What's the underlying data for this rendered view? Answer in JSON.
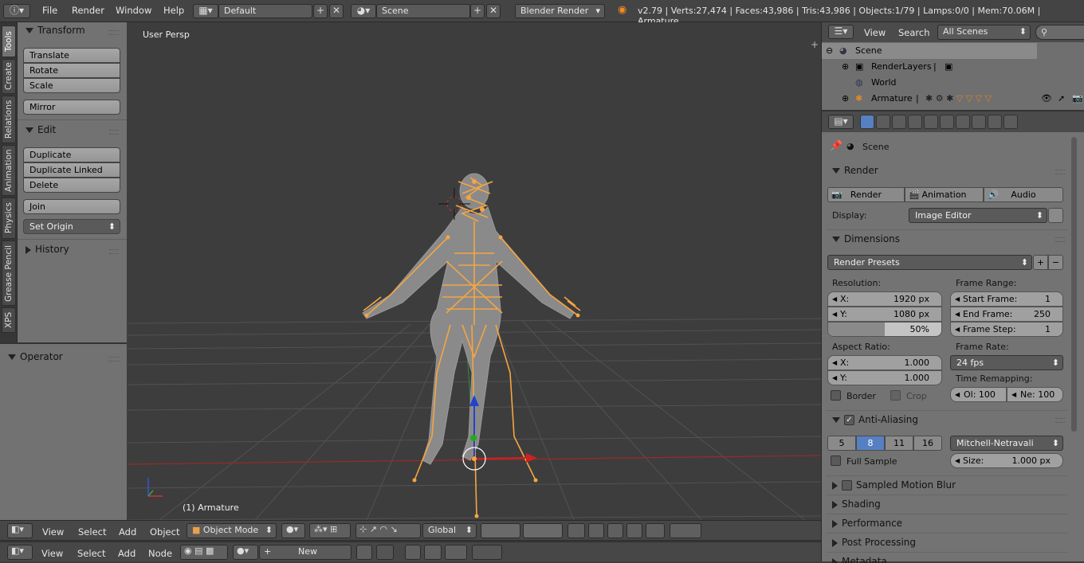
{
  "topbar": {
    "menus": [
      "File",
      "Render",
      "Window",
      "Help"
    ],
    "layout": "Default",
    "scene": "Scene",
    "engine": "Blender Render",
    "stats": "v2.79 | Verts:27,474 | Faces:43,986 | Tris:43,986 | Objects:1/79 | Lamps:0/0 | Mem:70.06M | Armature"
  },
  "tabs": [
    "Tools",
    "Create",
    "Relations",
    "Animation",
    "Physics",
    "Grease Pencil",
    "XPS"
  ],
  "toolshelf": {
    "transform": {
      "title": "Transform",
      "buttons": [
        "Translate",
        "Rotate",
        "Scale",
        "Mirror"
      ]
    },
    "edit": {
      "title": "Edit",
      "buttons": [
        "Duplicate",
        "Duplicate Linked",
        "Delete",
        "Join",
        "Set Origin"
      ]
    },
    "history": "History"
  },
  "operator": "Operator",
  "viewport": {
    "view_label": "User Persp",
    "object_label": "(1) Armature"
  },
  "view3d_header": {
    "menus": [
      "View",
      "Select",
      "Add",
      "Object"
    ],
    "mode": "Object Mode",
    "orientation": "Global"
  },
  "node_header": {
    "menus": [
      "View",
      "Select",
      "Add",
      "Node"
    ],
    "new_label": "New"
  },
  "outliner": {
    "menus": [
      "View",
      "Search"
    ],
    "filter": "All Scenes",
    "items": [
      "Scene",
      "RenderLayers",
      "World",
      "Armature"
    ]
  },
  "properties": {
    "context": "Scene",
    "render": {
      "title": "Render",
      "buttons": [
        "Render",
        "Animation",
        "Audio"
      ],
      "display_label": "Display:",
      "display_value": "Image Editor"
    },
    "dimensions": {
      "title": "Dimensions",
      "presets": "Render Presets",
      "resolution_label": "Resolution:",
      "res_x_label": "X:",
      "res_x": "1920 px",
      "res_y_label": "Y:",
      "res_y": "1080 px",
      "res_pct": "50%",
      "res_pct_fill": 0.5,
      "frame_range_label": "Frame Range:",
      "start_label": "Start Frame:",
      "start": "1",
      "end_label": "End Frame:",
      "end": "250",
      "step_label": "Frame Step:",
      "step": "1",
      "aspect_label": "Aspect Ratio:",
      "asp_x_label": "X:",
      "asp_x": "1.000",
      "asp_y_label": "Y:",
      "asp_y": "1.000",
      "frame_rate_label": "Frame Rate:",
      "fps": "24 fps",
      "time_remap_label": "Time Remapping:",
      "old": "Ol: 100",
      "new": "Ne: 100",
      "border": "Border",
      "crop": "Crop"
    },
    "aa": {
      "title": "Anti-Aliasing",
      "samples": [
        "5",
        "8",
        "11",
        "16"
      ],
      "active_sample": "8",
      "filter": "Mitchell-Netravali",
      "full_sample": "Full Sample",
      "size_label": "Size:",
      "size": "1.000 px"
    },
    "collapsed": [
      "Sampled Motion Blur",
      "Shading",
      "Performance",
      "Post Processing",
      "Metadata"
    ]
  },
  "colors": {
    "accent_blue": "#5680c2",
    "armature_orange": "#f5a542",
    "grid": "#555555"
  }
}
